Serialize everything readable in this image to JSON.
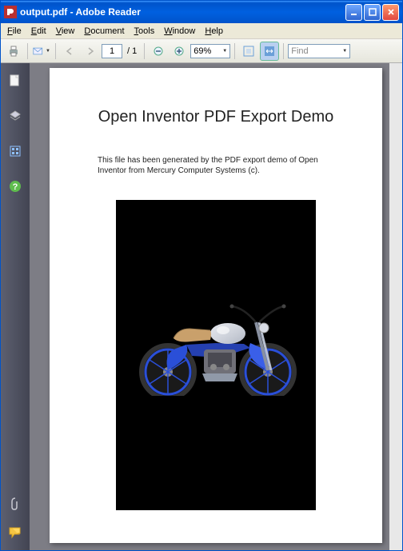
{
  "titlebar": {
    "filename": "output.pdf",
    "appname": "Adobe Reader"
  },
  "menubar": {
    "file": "File",
    "edit": "Edit",
    "view": "View",
    "document": "Document",
    "tools": "Tools",
    "window": "Window",
    "help": "Help"
  },
  "toolbar": {
    "current_page": "1",
    "total_pages": "/ 1",
    "zoom": "69%",
    "find_placeholder": "Find"
  },
  "document": {
    "title": "Open Inventor PDF Export Demo",
    "body": "This file has been generated by the PDF export demo of Open Inventor from Mercury Computer Systems (c).",
    "embedded_content": "3D motorcycle model (blue frame, chrome tank, tan seat)"
  },
  "colors": {
    "titlebar_start": "#3a95ff",
    "titlebar_end": "#0053ca",
    "sidebar": "#424452",
    "doc_bg": "#7d7d85",
    "moto_blue": "#2a4fd8",
    "moto_seat": "#c9a06b",
    "moto_chrome": "#d8dce5"
  }
}
